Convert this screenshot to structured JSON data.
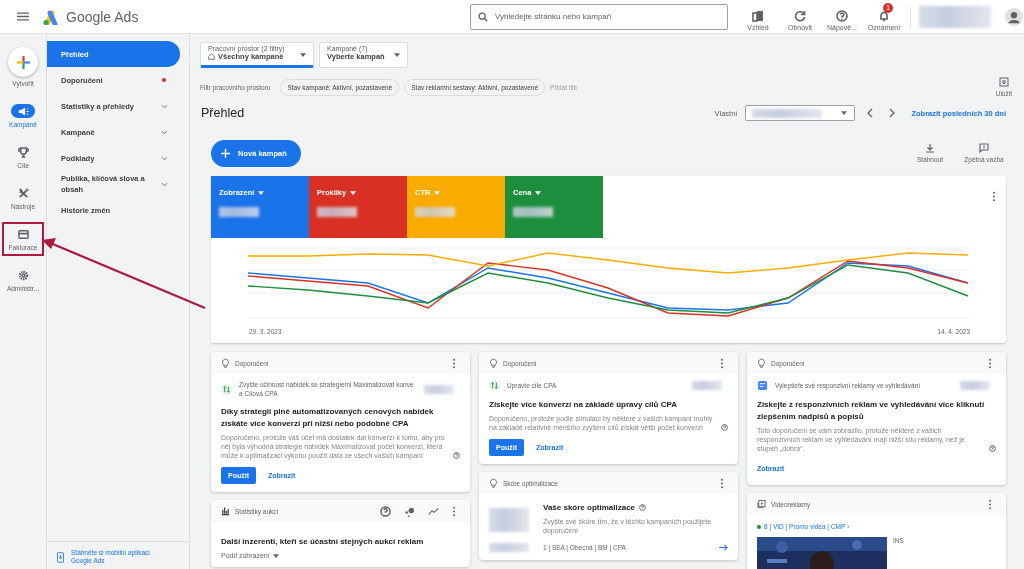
{
  "header": {
    "logo_text": "Google Ads",
    "search": {
      "placeholder": "Vyhledejte stránku nebo kampaň"
    },
    "actions": [
      {
        "label": "Vzhled",
        "kind": "appearance"
      },
      {
        "label": "Obnovit",
        "kind": "refresh"
      },
      {
        "label": "Nápově...",
        "kind": "help"
      },
      {
        "label": "Oznámení",
        "kind": "notifications",
        "badge": "1"
      }
    ]
  },
  "rail": [
    {
      "label": "Vytvořit",
      "kind": "create",
      "selected": false,
      "highlighted": false
    },
    {
      "label": "Kampaně",
      "kind": "campaigns",
      "selected": true,
      "highlighted": false
    },
    {
      "label": "Cíle",
      "kind": "goals",
      "selected": false,
      "highlighted": false
    },
    {
      "label": "Nástroje",
      "kind": "tools",
      "selected": false,
      "highlighted": false
    },
    {
      "label": "Fakturace",
      "kind": "billing",
      "selected": false,
      "highlighted": true
    },
    {
      "label": "Administr...",
      "kind": "admin",
      "selected": false,
      "highlighted": false
    }
  ],
  "nav": {
    "items": [
      {
        "label": "Přehled",
        "selected": true,
        "expandable": false,
        "alert": false
      },
      {
        "label": "Doporučení",
        "selected": false,
        "expandable": false,
        "alert": true
      },
      {
        "label": "Statistiky a přehledy",
        "selected": false,
        "expandable": true,
        "alert": false
      },
      {
        "label": "Kampaně",
        "selected": false,
        "expandable": true,
        "alert": false
      },
      {
        "label": "Podklady",
        "selected": false,
        "expandable": true,
        "alert": false
      },
      {
        "label": "Publika, klíčová slova a obsah",
        "selected": false,
        "expandable": true,
        "alert": false
      },
      {
        "label": "Historie změn",
        "selected": false,
        "expandable": false,
        "alert": false
      }
    ],
    "footer": "Stáhněte si mobilní aplikaci Google Ads"
  },
  "toolbar": {
    "workspace": {
      "label": "Pracovní prostor (2 filtry)",
      "value": "Všechny kampaně"
    },
    "campaigns": {
      "label": "Kampaně (7)",
      "value": "Vyberte kampaň"
    },
    "filter_label": "Filtr pracovního prostoru",
    "filters": [
      "Stav kampaně: Aktivní, pozastavené",
      "Stav reklamní sestavy: Aktivní, pozastavené"
    ],
    "add_filter": "Přidat filtr",
    "save": "Uložit"
  },
  "overview": {
    "title": "Přehled",
    "range_label": "Vlastní",
    "range_shortcut": "Zobrazit posledních 30 dní",
    "new_campaign": "Nová kampaň",
    "actions": [
      {
        "label": "Stáhnout",
        "kind": "download"
      },
      {
        "label": "Zpětná vazba",
        "kind": "feedback"
      }
    ]
  },
  "chart": {
    "metrics": [
      {
        "label": "Zobrazení",
        "color": "#1a73e8"
      },
      {
        "label": "Prokliky",
        "color": "#d93025"
      },
      {
        "label": "CTR",
        "color": "#f9ab00"
      },
      {
        "label": "Cena",
        "color": "#1e8e3e"
      }
    ],
    "x_start": "29. 3. 2023",
    "x_end": "14. 4. 2023"
  },
  "cards": [
    {
      "kind": "recommendation",
      "header": "Doporučení",
      "subtitle": "Zvyšte účinnost nabídek se strategiemi Maximalizovat konve a Cílová CPA",
      "title": "Díky strategii plně automatizovaných cenových nabídek získáte více konverzí při nižší nebo podobné CPA",
      "body": "Doporučeno, protože váš účet má dostatek dat konverzí k tomu, aby pro něj byla výhodná strategie nabídek Maximalizovat počet konverzí, která může k optimalizaci výkonu použít data ze všech vašich kampaní",
      "apply": "Použít",
      "view": "Zobrazit"
    },
    {
      "kind": "recommendation",
      "header": "Doporučení",
      "subtitle": "Upravte cíle CPA",
      "title": "Získejte více konverzí na základě úpravy cílů CPA",
      "body": "Doporučeno, protože podle simulací by některé z vašich kampaní mohly na základě relativně menšího zvýšení cílů získat větší počet konverzí",
      "apply": "Použít",
      "view": "Zobrazit"
    },
    {
      "kind": "recommendation",
      "header": "Doporučení",
      "subtitle": "Vylepšete své responzivní reklamy ve vyhledávání",
      "title": "Získejte z responzivních reklam ve vyhledávání více kliknutí zlepšením nadpisů a popisů",
      "body": "Toto doporučení se vám zobrazilo, protože některé z vašich responzivních reklam ve vyhledávání mají nižší sílu reklamy, než je stupeň „dobrá“.",
      "view": "Zobrazit"
    },
    {
      "kind": "auction",
      "header": "Statistiky aukcí",
      "title": "Další inzerenti, kteří se účastní stejných aukcí reklam",
      "dropdown": "Podíl zobrazení"
    },
    {
      "kind": "score",
      "header": "Skóre optimalizace",
      "title": "Vaše skóre optimalizace",
      "body": "Zvyšte své skóre tím, že v těchto kampaních použijete doporučení",
      "campaign": "1 | SEA | Obecná | BM | CPA"
    },
    {
      "kind": "video",
      "header": "Videoreklamy",
      "campaign": "8 | VID | Promo videa | CMP ›",
      "enabled": true,
      "video_title": "INS"
    }
  ]
}
